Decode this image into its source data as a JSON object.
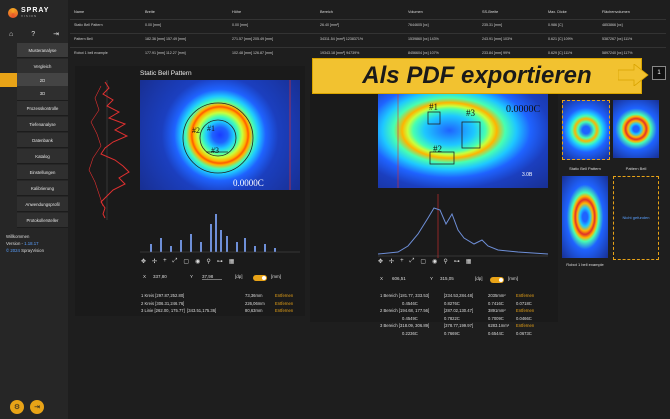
{
  "app": {
    "name": "SPRAY",
    "sub": "VISION"
  },
  "nav": {
    "items": [
      "Musteranalyse",
      "Vergleich",
      "2D",
      "3D",
      "Prozesskontrolle",
      "Tiefenanalyse",
      "Datenbank",
      "Katalog",
      "Einstellungen",
      "Kalibrierung",
      "Anwendungsprofil",
      "Protokollersteller"
    ]
  },
  "welcome": {
    "line1": "Willkommen",
    "line2": "Version -",
    "version": "1.18.17",
    "line3a": "© 2024",
    "line3b": " SprayVision"
  },
  "table": {
    "headers": [
      "Name",
      "Breite",
      "Höhe",
      "Bereich",
      "Volumen",
      "SS-Breite",
      "Max. Dicke",
      "Flächenvolumen"
    ],
    "rows": [
      [
        "Static Bell Pattern",
        "0.00 [mm]",
        "0.00 [mm]",
        "26.40 [mm²]",
        "7644605 [xx]",
        "235.31 [mm]",
        "0.986 [C]",
        "4853866 [xx]"
      ],
      [
        "Pattern Bell",
        "182.36 [mm] 157.49 [mm]",
        "271.57 [mm] 205.49 [mm]",
        "34311.54 [mm²] 1238371%",
        "1539860 [xx] 143%",
        "243.91 [mm] 103%",
        "0.621 [C] 109%",
        "5387267 [xx] 111%"
      ],
      [
        "Robot 1 bell example",
        "177.91 [mm] 112.27 [mm]",
        "102.48 [mm] 126.87 [mm]",
        "19343.18 [mm²] 94739%",
        "8456604 [xx] 107%",
        "233.84 [mm] 99%",
        "0.629 [C] 111%",
        "5897240 [xx] 117%"
      ]
    ]
  },
  "left_panel": {
    "title": "Static Bell Pattern",
    "scale_value": "0.0000C",
    "labels": [
      "#1",
      "#2",
      "#3"
    ],
    "x_label": "X",
    "x_value": "337,80",
    "y_label": "Y",
    "y_value": "37,98",
    "deg": "[dp]",
    "mm": "[mm]",
    "stats": [
      {
        "name": "1 Kreis",
        "coords": "[297.87,252.80]",
        "value": "73,36mm",
        "action": "Entfernen"
      },
      {
        "name": "2 Kreis",
        "coords": "[306.31,246.76]",
        "value": "226,06mm",
        "action": "Entfernen"
      },
      {
        "name": "3 Linie",
        "coords": "[262.00, 175.77]",
        "coords2": "[343.51,175.36]",
        "value": "80,63mm",
        "action": "Entfernen"
      }
    ]
  },
  "right_panel": {
    "scale_value": "0.0000C",
    "side_value": "3.0B",
    "labels": [
      "#1",
      "#2",
      "#3"
    ],
    "x_label": "X",
    "x_value": "606,51",
    "y_label": "Y",
    "y_value": "315,05",
    "deg": "[dp]",
    "mm": "[mm]",
    "stats": [
      {
        "name": "1 Bereich",
        "a": "[181.77, 333.53]",
        "b": "0.4546C",
        "c": "[234.53,284.48]",
        "d": "0.8276C",
        "e": "2035mm²",
        "f": "0.7416C",
        "action": "Entfernen",
        "g": "0.0718C"
      },
      {
        "name": "2 Bereich",
        "a": "[194.68, 177.56]",
        "b": "0.4549C",
        "c": "[287.02,130.47]",
        "d": "0.7822C",
        "e": "3891mm²",
        "f": "0.7009C",
        "action": "Entfernen",
        "g": "0.0466C"
      },
      {
        "name": "3 Bereich",
        "a": "[318.09, 306.89]",
        "b": "0.2236C",
        "c": "[378.77,199.97]",
        "d": "0.7669C",
        "e": "6283.1mm²",
        "f": "0.6544C",
        "action": "Entfernen",
        "g": "0.0673C"
      }
    ]
  },
  "thumbnails": [
    {
      "label": "Static Bell Pattern"
    },
    {
      "label": "Pattern Bell"
    },
    {
      "label": "Robot 1 bell example"
    },
    {
      "label": "Nicht gefunden"
    }
  ],
  "banner": {
    "text": "Als PDF exportieren"
  },
  "export_badge": "1",
  "colors": {
    "accent": "#e8a317",
    "banner": "#f2c230",
    "background": "#1e1e1e"
  }
}
